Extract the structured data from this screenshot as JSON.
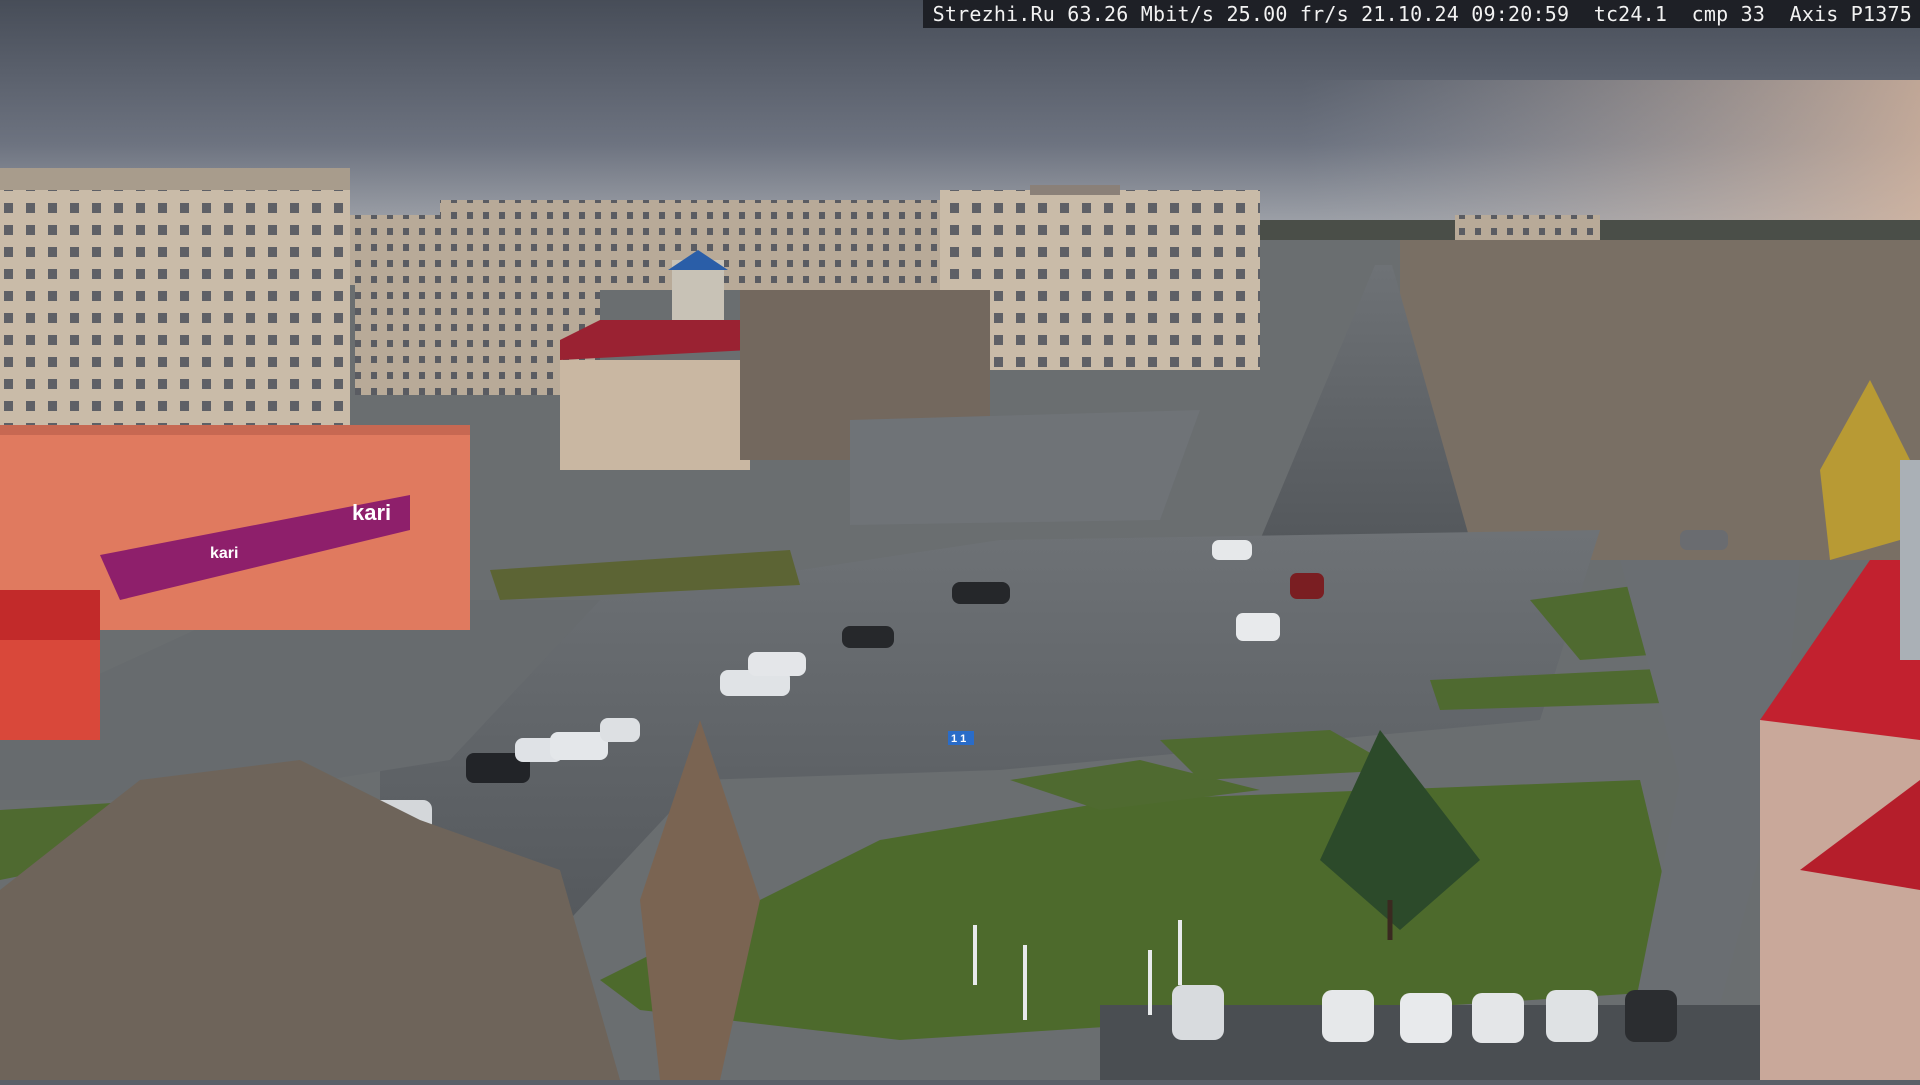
{
  "overlay": {
    "site": "Strezhi.Ru",
    "bitrate": "63.26 Mbit/s",
    "framerate": "25.00 fr/s",
    "datetime": "21.10.24 09:20:59",
    "tc": "tc24.1",
    "cmp": "cmp 33",
    "camera": "Axis P1375"
  },
  "signs": {
    "kari_main": "kari",
    "kari_sub": "kari",
    "lane_sign": "1 1"
  },
  "colors": {
    "sky_top": "#4f5560",
    "sky_horizon": "#9aa0a8",
    "asphalt": "#5d6166",
    "grass": "#4d6a2c",
    "brick": "#c8b9a6",
    "store_orange": "#e07a5f",
    "store_magenta": "#8e1f6b",
    "roof_red": "#c2212f"
  }
}
